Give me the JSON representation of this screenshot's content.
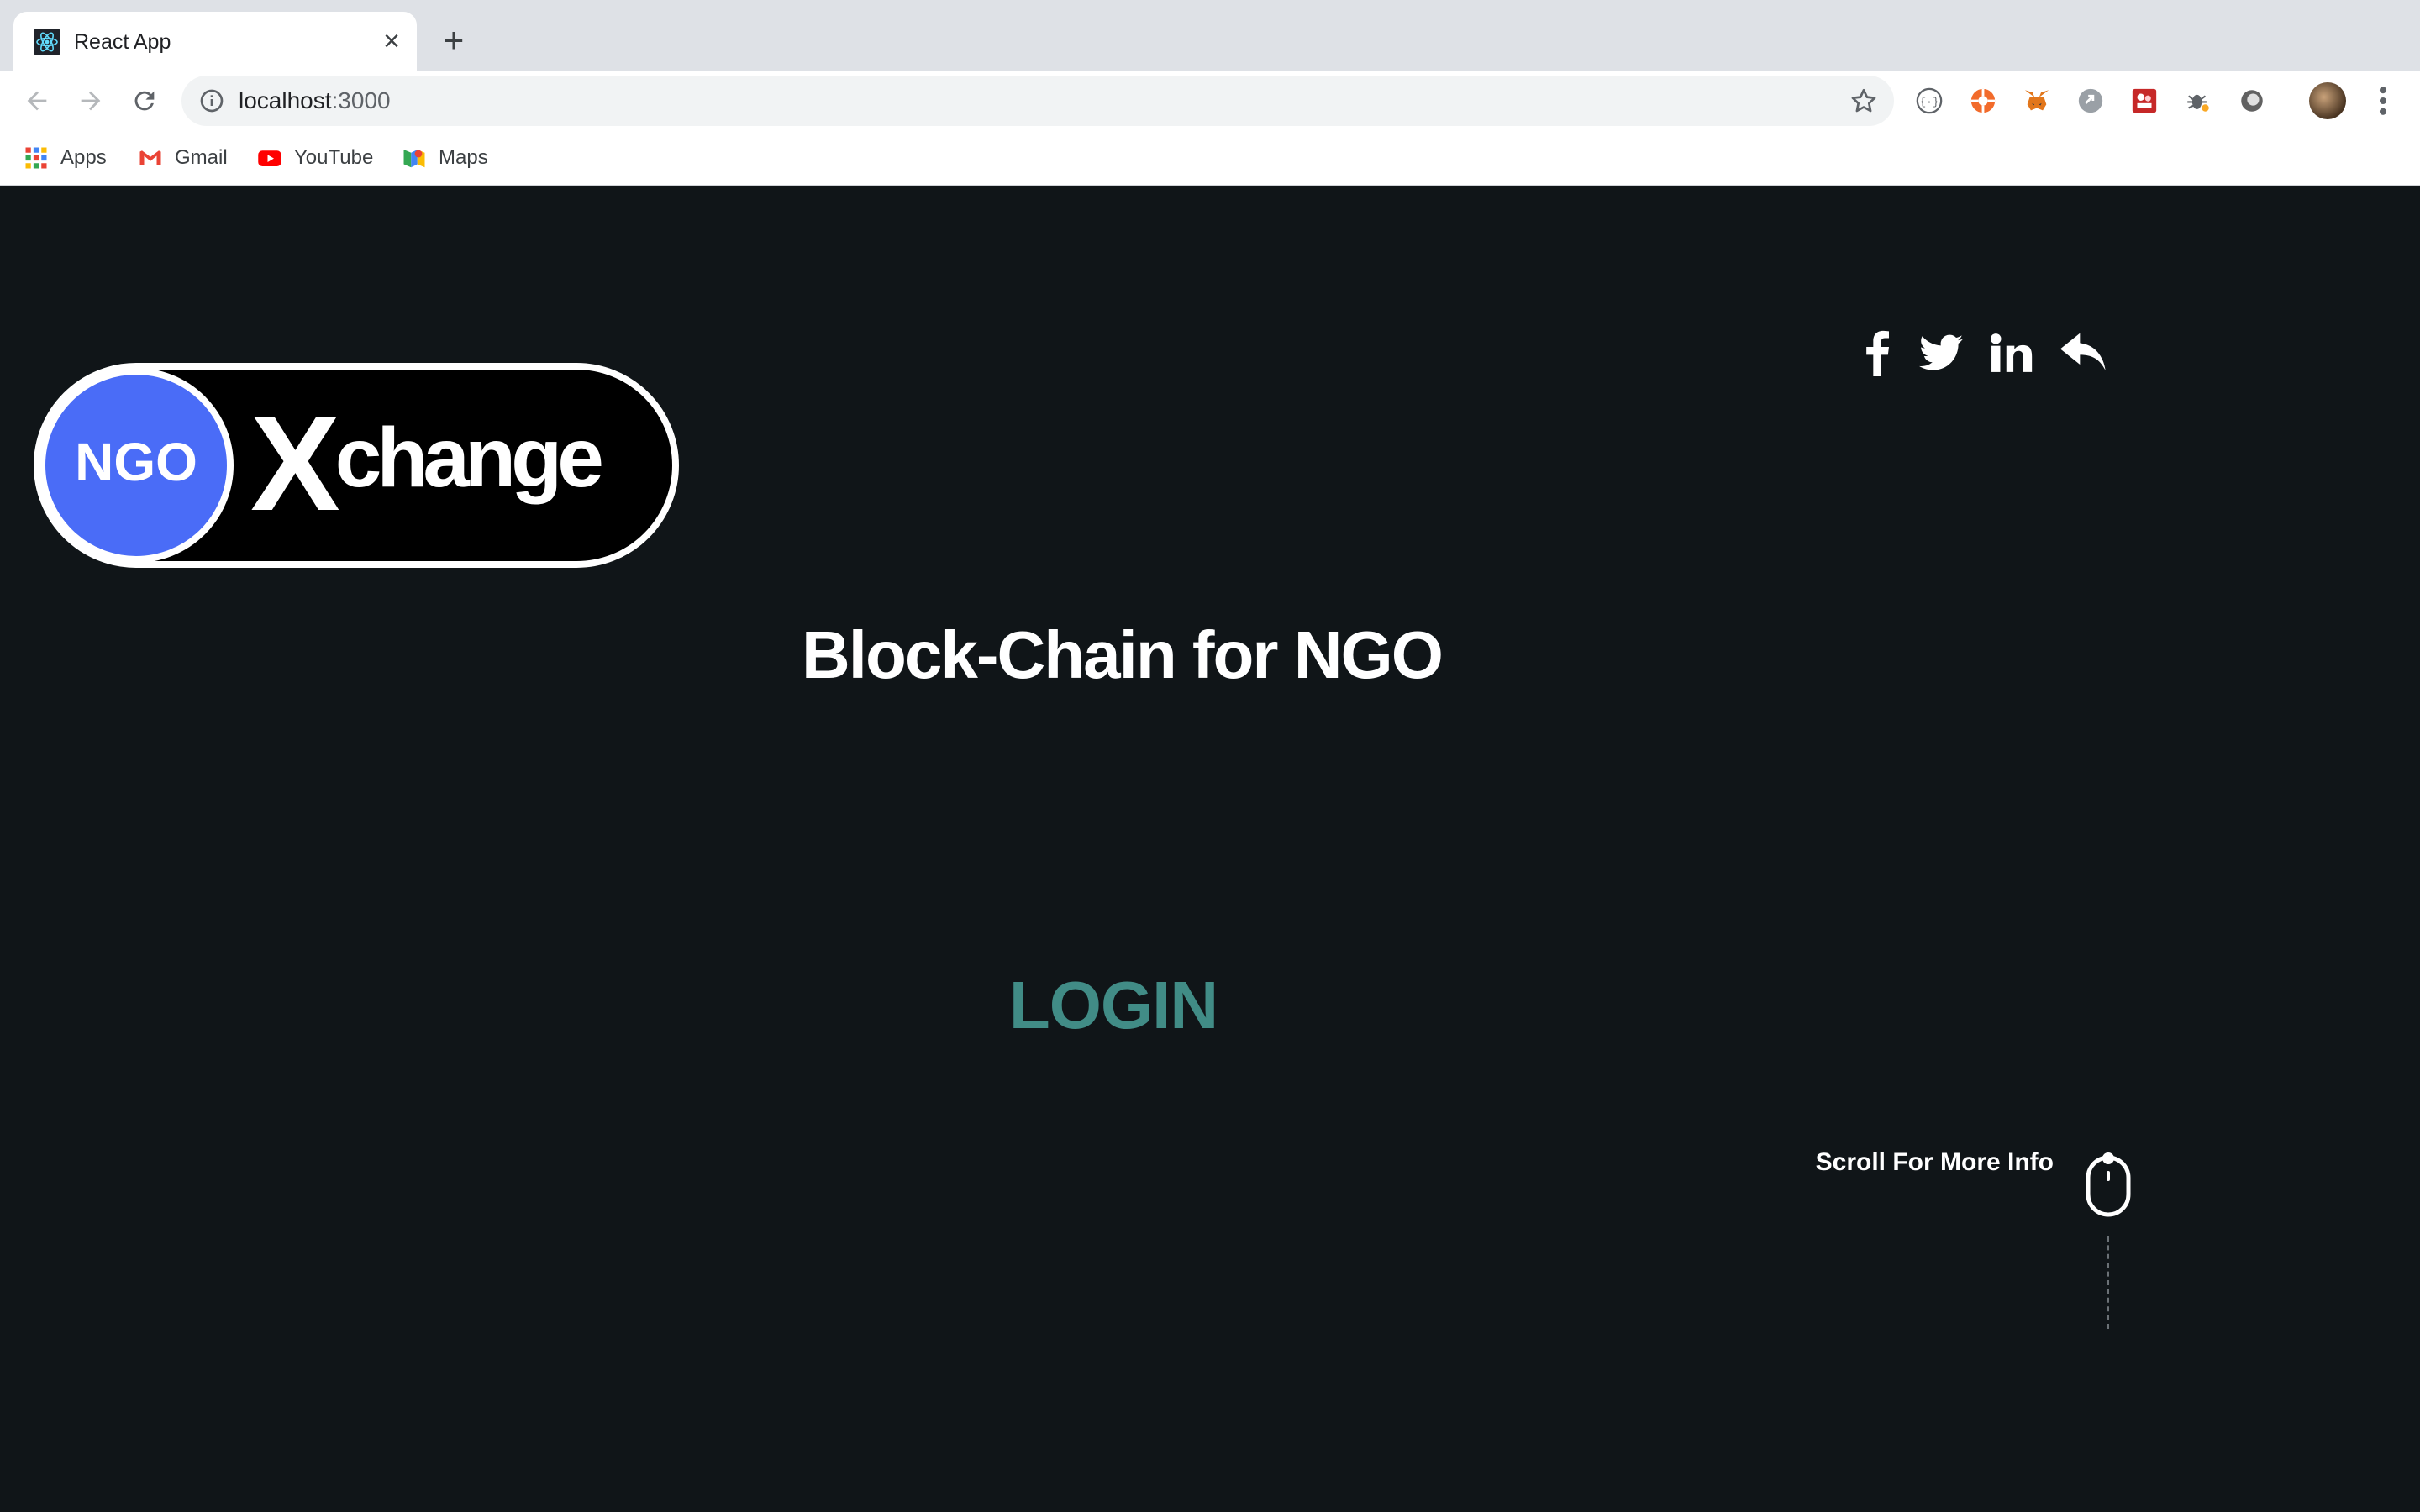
{
  "browser": {
    "tab": {
      "title": "React App",
      "favicon": "react-icon",
      "close": "close-icon"
    },
    "new_tab": "plus-icon",
    "omnibox": {
      "host": "localhost",
      "port": ":3000",
      "info_icon": "info-icon",
      "star_icon": "star-icon"
    },
    "extensions": [
      "code-braces-icon",
      "orange-lifebuoy-icon",
      "metamask-fox-icon",
      "grey-link-icon",
      "red-grid-extension-icon",
      "bug-extension-icon",
      "grey-circle-extension-icon"
    ],
    "bookmarks": [
      {
        "label": "Apps",
        "icon": "apps-grid-icon"
      },
      {
        "label": "Gmail",
        "icon": "gmail-icon"
      },
      {
        "label": "YouTube",
        "icon": "youtube-icon"
      },
      {
        "label": "Maps",
        "icon": "maps-icon"
      }
    ]
  },
  "page": {
    "logo": {
      "circle_text": "NGO",
      "wordmark": "Xchange"
    },
    "social": [
      "facebook-icon",
      "twitter-icon",
      "linkedin-icon",
      "reply-icon"
    ],
    "headline": "Block-Chain for NGO",
    "login_label": "LOGIN",
    "scroll_label": "Scroll For More Info"
  },
  "colors": {
    "background": "#101518",
    "login": "#418c86",
    "logo_blue": "#4a6cf7",
    "text": "#ffffff"
  }
}
